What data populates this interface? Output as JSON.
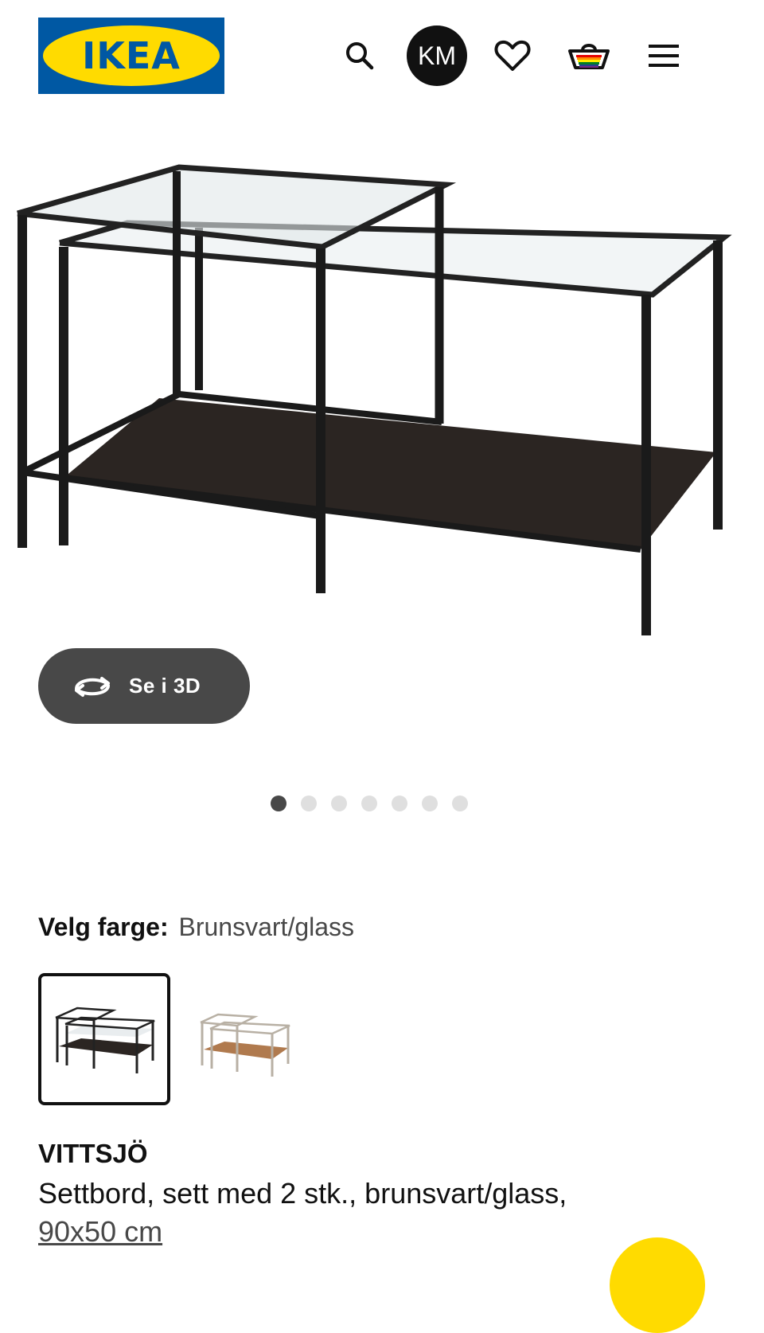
{
  "header": {
    "logo_text": "IKEA",
    "avatar_initials": "KM",
    "icons": [
      "search-icon",
      "heart-icon",
      "basket-icon",
      "menu-icon"
    ],
    "brand_blue": "#0058a3",
    "brand_yellow": "#ffdb00"
  },
  "gallery": {
    "view_3d_label": "Se i 3D",
    "dot_count": 7,
    "active_dot": 1
  },
  "color_selector": {
    "label": "Velg farge:",
    "value": "Brunsvart/glass",
    "options": [
      "Brunsvart/glass",
      "Hvit/glass"
    ],
    "selected_index": 0
  },
  "product": {
    "name": "VITTSJÖ",
    "description": "Settbord, sett med 2 stk., brunsvart/glass,",
    "size": "90x50 cm"
  }
}
